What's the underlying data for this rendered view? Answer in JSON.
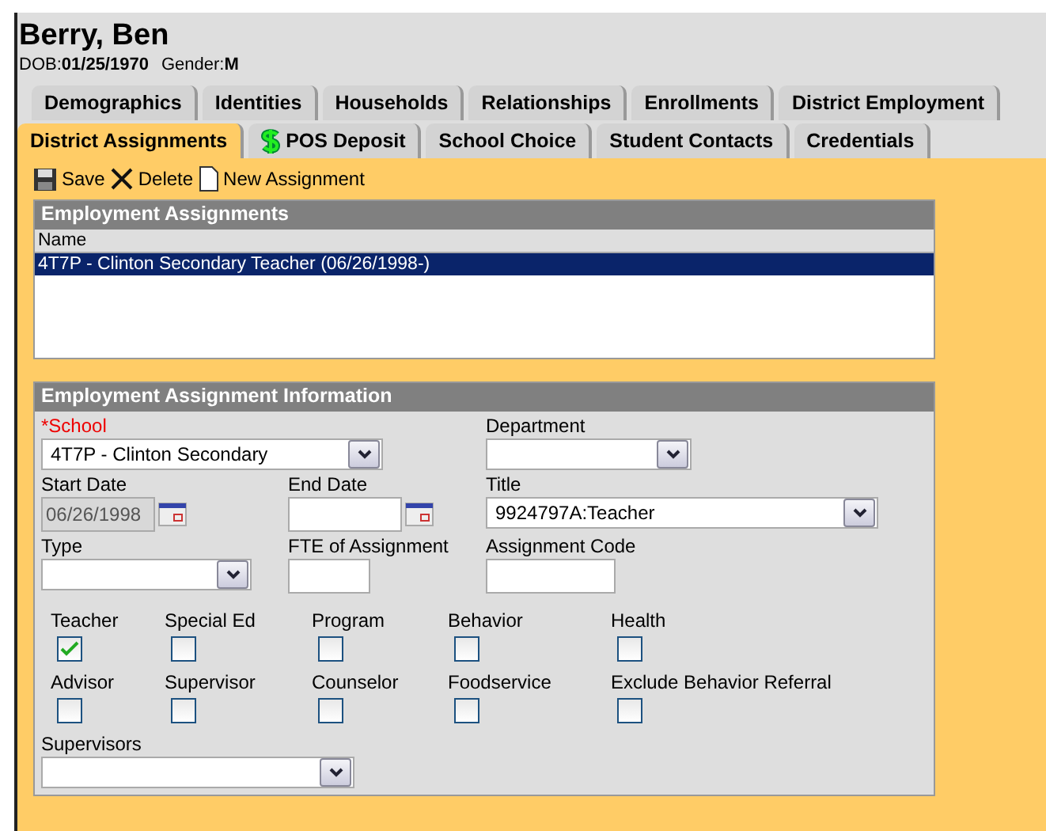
{
  "person": {
    "name": "Berry, Ben",
    "dob_label": "DOB:",
    "dob": "01/25/1970",
    "gender_label": "Gender:",
    "gender": "M"
  },
  "tab_rows": [
    [
      {
        "label": "Demographics",
        "selected": false
      },
      {
        "label": "Identities",
        "selected": false
      },
      {
        "label": "Households",
        "selected": false
      },
      {
        "label": "Relationships",
        "selected": false
      },
      {
        "label": "Enrollments",
        "selected": false
      },
      {
        "label": "District Employment",
        "selected": false
      }
    ],
    [
      {
        "label": "District Assignments",
        "selected": true
      },
      {
        "label": "POS Deposit",
        "selected": false,
        "kind": "deposit"
      },
      {
        "label": "School Choice",
        "selected": false
      },
      {
        "label": "Student Contacts",
        "selected": false
      },
      {
        "label": "Credentials",
        "selected": false
      }
    ]
  ],
  "toolbar": [
    {
      "label": "Save",
      "kind": "save"
    },
    {
      "label": "Delete",
      "kind": "delete"
    },
    {
      "label": "New Assignment",
      "kind": "new"
    }
  ],
  "assignments": {
    "title": "Employment Assignments",
    "column": "Name",
    "rows": [
      {
        "text": "4T7P - Clinton Secondary Teacher (06/26/1998-)",
        "selected": true
      }
    ]
  },
  "info": {
    "title": "Employment Assignment Information",
    "fields": [
      {
        "kind": "select",
        "label": "*School",
        "required": true,
        "value": "4T7P - Clinton Secondary"
      },
      {
        "kind": "select",
        "label": "Department",
        "required": false
      },
      {
        "kind": "date",
        "label": "Start Date",
        "required": false,
        "value": "06/26/1998",
        "disabled": true
      },
      {
        "kind": "date",
        "label": "End Date",
        "required": false,
        "disabled": false
      },
      {
        "kind": "select",
        "label": "Title",
        "required": false,
        "value": "9924797A:Teacher"
      },
      {
        "kind": "select",
        "label": "Type",
        "required": false
      },
      {
        "kind": "text",
        "label": "FTE of Assignment",
        "required": false
      },
      {
        "kind": "text",
        "label": "Assignment Code",
        "required": false
      }
    ],
    "checkboxes": [
      {
        "label": "Teacher",
        "checked": true
      },
      {
        "label": "Special Ed",
        "checked": false
      },
      {
        "label": "Program",
        "checked": false
      },
      {
        "label": "Behavior",
        "checked": false
      },
      {
        "label": "Health",
        "checked": false
      },
      {
        "label": "Advisor",
        "checked": false
      },
      {
        "label": "Supervisor",
        "checked": false
      },
      {
        "label": "Counselor",
        "checked": false
      },
      {
        "label": "Foodservice",
        "checked": false
      },
      {
        "label": "Exclude Behavior Referral",
        "checked": false
      }
    ],
    "supervisors": {
      "label": "Supervisors"
    }
  }
}
